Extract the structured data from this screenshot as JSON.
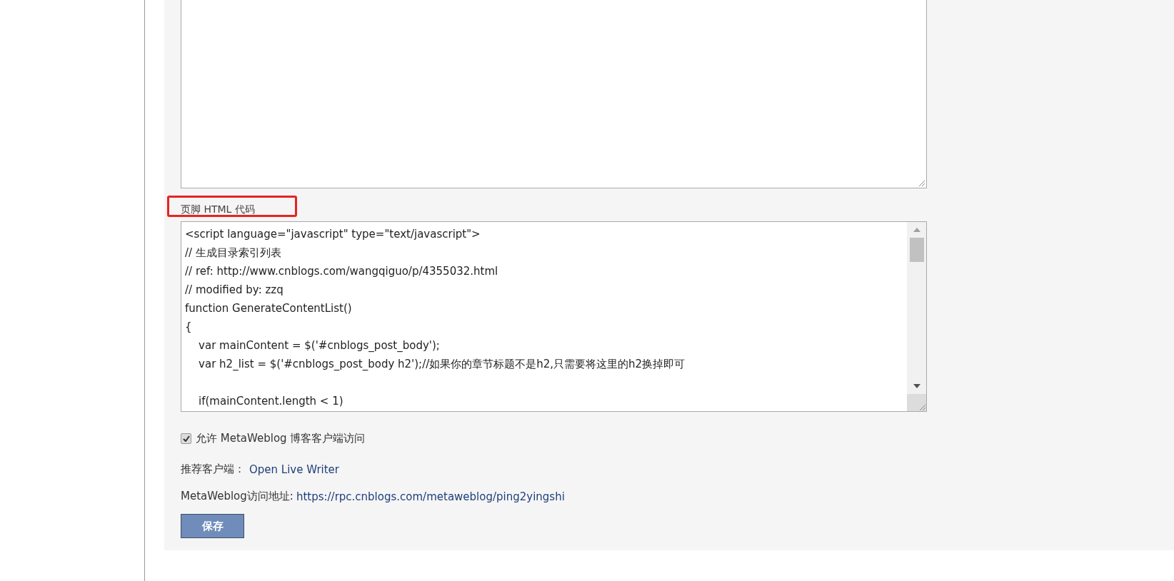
{
  "footer_code": {
    "label": "页脚 HTML 代码",
    "value": "<script language=\"javascript\" type=\"text/javascript\">\n// 生成目录索引列表\n// ref: http://www.cnblogs.com/wangqiguo/p/4355032.html\n// modified by: zzq\nfunction GenerateContentList()\n{\n    var mainContent = $('#cnblogs_post_body');\n    var h2_list = $('#cnblogs_post_body h2');//如果你的章节标题不是h2,只需要将这里的h2换掉即可\n\n    if(mainContent.length < 1)"
  },
  "metaweblog": {
    "label": "允许 MetaWeblog 博客客户端访问",
    "checked": true
  },
  "recommended": {
    "label": "推荐客户端：",
    "link": "Open Live Writer"
  },
  "address": {
    "label": "MetaWeblog访问地址:",
    "link": "https://rpc.cnblogs.com/metaweblog/ping2yingshi"
  },
  "save_button": "保存"
}
